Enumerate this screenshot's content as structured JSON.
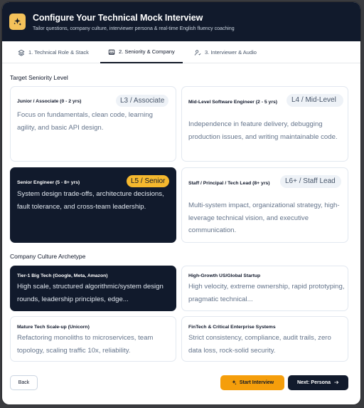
{
  "header": {
    "title": "Configure Your Technical Mock Interview",
    "subtitle": "Tailor questions, company culture, interviewer persona & real-time English fluency coaching"
  },
  "tabs": [
    {
      "label": "1. Technical Role & Stack",
      "icon": "layers-icon",
      "active": false
    },
    {
      "label": "2. Seniority & Company",
      "icon": "building-icon",
      "active": true
    },
    {
      "label": "3. Interviewer & Audio",
      "icon": "user-icon",
      "active": false
    }
  ],
  "seniority": {
    "section_label": "Target Seniority Level",
    "options": [
      {
        "title": "Junior / Associate (0 - 2 yrs)",
        "badge": "L3 / Associate",
        "desc": "Focus on fundamentals, clean code, learning agility, and basic API design.",
        "selected": false
      },
      {
        "title": "Mid-Level Software Engineer (2 - 5 yrs)",
        "badge": "L4 / Mid-Level",
        "desc": "Independence in feature delivery, debugging production issues, and writing maintainable code.",
        "selected": false
      },
      {
        "title": "Senior Engineer (5 - 8+ yrs)",
        "badge": "L5 / Senior",
        "desc": "System design trade-offs, architecture decisions, fault tolerance, and cross-team leadership.",
        "selected": true
      },
      {
        "title": "Staff / Principal / Tech Lead (8+ yrs)",
        "badge": "L6+ / Staff Lead",
        "desc": "Multi-system impact, organizational strategy, high-leverage technical vision, and executive communication.",
        "selected": false
      }
    ]
  },
  "culture": {
    "section_label": "Company Culture Archetype",
    "options": [
      {
        "title": "Tier-1 Big Tech (Google, Meta, Amazon)",
        "desc": "High scale, structured algorithmic/system design rounds, leadership principles, edge...",
        "selected": true
      },
      {
        "title": "High-Growth US/Global Startup",
        "desc": "High velocity, extreme ownership, rapid prototyping, pragmatic technical...",
        "selected": false
      },
      {
        "title": "Mature Tech Scale-up (Unicorn)",
        "desc": "Refactoring monoliths to microservices, team topology, scaling traffic 10x, reliability.",
        "selected": false
      },
      {
        "title": "FinTech & Critical Enterprise Systems",
        "desc": "Strict consistency, compliance, audit trails, zero data loss, rock-solid security.",
        "selected": false
      }
    ]
  },
  "footer": {
    "back_label": "Back",
    "start_label": "Start Interview",
    "next_label": "Next: Persona"
  },
  "colors": {
    "header_bg": "#111a2c",
    "accent": "#f59e0b",
    "selected_card_bg": "#111a2c"
  }
}
